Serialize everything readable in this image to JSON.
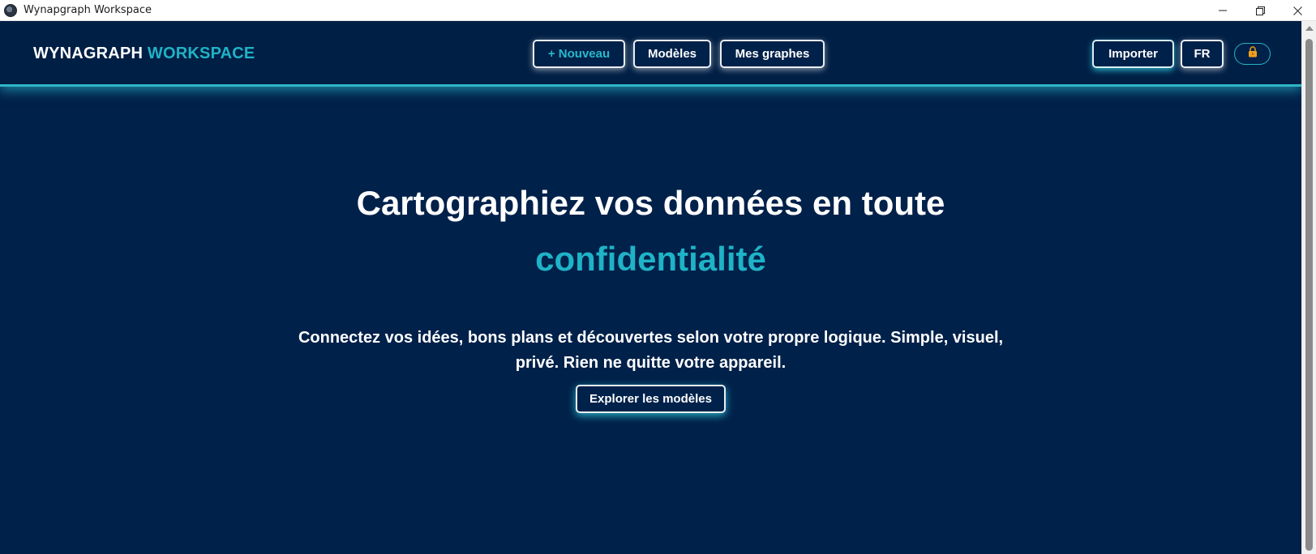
{
  "window": {
    "title": "Wynapgraph Workspace",
    "controls": [
      "minimize-icon",
      "restore-icon",
      "close-icon"
    ]
  },
  "header": {
    "logo_main": "WYNAGRAPH",
    "logo_accent": "WORKSPACE",
    "nav": {
      "new_label": "+ Nouveau",
      "templates_label": "Modèles",
      "my_graphs_label": "Mes graphes"
    },
    "import_label": "Importer",
    "language_label": "FR",
    "lock_icon": "lock-icon"
  },
  "hero": {
    "title": "Cartographiez vos données en toute",
    "title_accent": "confidentialité",
    "subtitle": "Connectez vos idées, bons plans et découvertes selon votre propre logique. Simple, visuel, privé. Rien ne quitte votre appareil.",
    "cta_label": "Explorer les modèles"
  },
  "colors": {
    "background": "#00214a",
    "accent": "#1fb3c7",
    "text": "#ffffff",
    "lock": "#f0a020"
  }
}
